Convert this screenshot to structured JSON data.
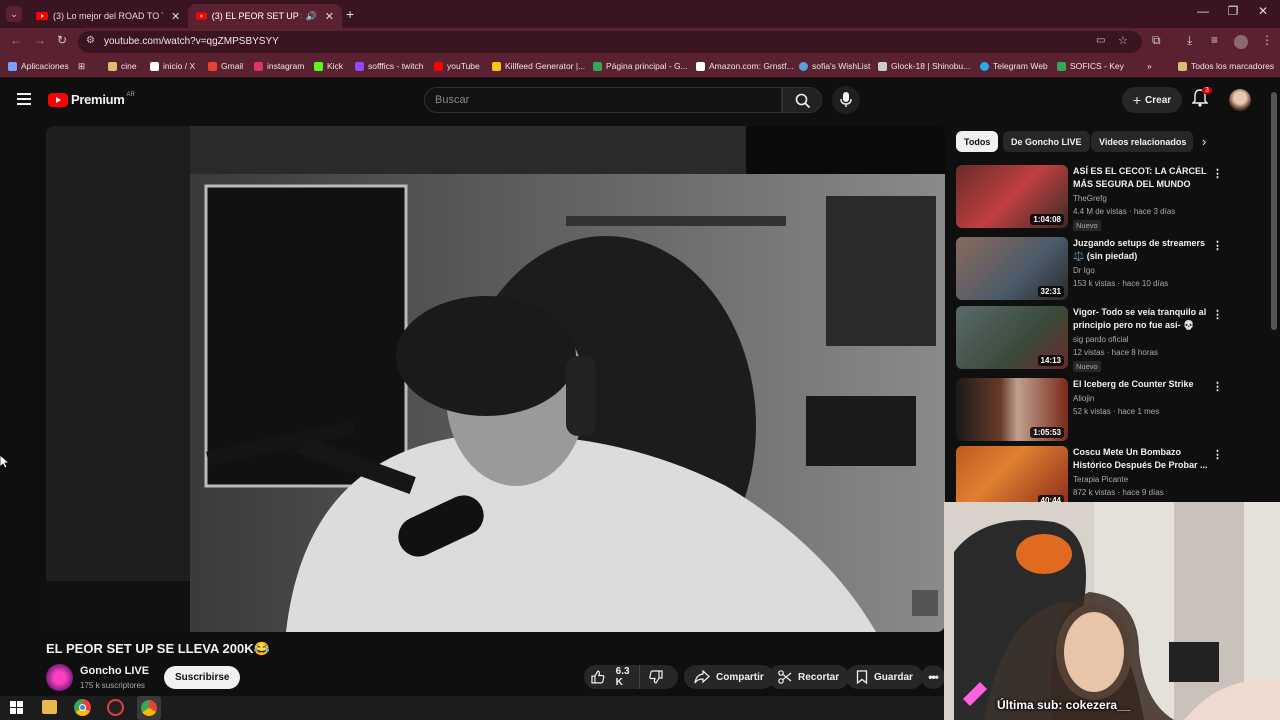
{
  "browser": {
    "tabs": [
      {
        "title": "(3) Lo mejor del ROAD TO TOP",
        "active": false
      },
      {
        "title": "(3) EL PEOR SET UP SE LLEV",
        "active": true
      }
    ],
    "url": "youtube.com/watch?v=qgZMPSBYSYY",
    "bookmarks": [
      {
        "label": "Aplicaciones",
        "color": "#7aa0ff"
      },
      {
        "label": "cine",
        "color": "#d8c070"
      },
      {
        "label": "inicio / X",
        "color": "#ffffff"
      },
      {
        "label": "Gmail",
        "color": "#ea4335"
      },
      {
        "label": "instagram",
        "color": "#e1306c"
      },
      {
        "label": "Kick",
        "color": "#53fc18"
      },
      {
        "label": "sofffics - twitch",
        "color": "#9146ff"
      },
      {
        "label": "youTube",
        "color": "#ff0000"
      },
      {
        "label": "Killfeed Generator |...",
        "color": "#f5c518"
      },
      {
        "label": "Página principal - G...",
        "color": "#34a853"
      },
      {
        "label": "Amazon.com: Grnstf...",
        "color": "#ffffff"
      },
      {
        "label": "sofia's WishList",
        "color": "#5aa0e0"
      },
      {
        "label": "Glock-18 | Shinobu...",
        "color": "#cccccc"
      },
      {
        "label": "Telegram Web",
        "color": "#2aabee"
      },
      {
        "label": "SOFICS - Key",
        "color": "#34a853"
      },
      {
        "label": "Todos los marcadores",
        "color": "#d8c070"
      }
    ]
  },
  "youtube": {
    "logo_text": "Premium",
    "region": "AR",
    "search_placeholder": "Buscar",
    "create_label": "Crear",
    "notif_count": "3"
  },
  "video": {
    "title": "EL PEOR SET UP SE LLEVA 200K😂",
    "channel": "Goncho LIVE",
    "subscribers": "175 k suscriptores",
    "subscribe_label": "Suscribirse",
    "likes": "6.3 K",
    "share_label": "Compartir",
    "clip_label": "Recortar",
    "save_label": "Guardar"
  },
  "sidebar": {
    "chips": [
      "Todos",
      "De Goncho LIVE",
      "Videos relacionados"
    ],
    "recommendations": [
      {
        "title": "ASÍ ES EL CECOT: LA CÁRCEL MÁS SEGURA DEL MUNDO",
        "channel": "TheGrefg",
        "meta": "4.4 M de vistas · hace 3 días",
        "duration": "1:04:08",
        "badge": "Nuevo",
        "color": "#b24040"
      },
      {
        "title": "Juzgando setups de streamers ⚖️ (sin piedad)",
        "channel": "Dr Igo",
        "meta": "153 k vistas · hace 10 días",
        "duration": "32:31",
        "badge": "",
        "color": "#6a7a8a"
      },
      {
        "title": "Vigor- Todo se veía tranquilo al principio pero no fue así- 💀",
        "channel": "sig pardo oficial",
        "meta": "12 vistas · hace 8 horas",
        "duration": "14:13",
        "badge": "Nuevo",
        "color": "#4a5a4a"
      },
      {
        "title": "El Iceberg de Counter Strike",
        "channel": "Aliojin",
        "meta": "52 k vistas · hace 1 mes",
        "duration": "1:05:53",
        "badge": "",
        "color": "#5a2a1a"
      },
      {
        "title": "Coscu Mete Un Bombazo Histórico Después De Probar ...",
        "channel": "Terapia Picante",
        "meta": "872 k vistas · hace 9 días",
        "duration": "40:44",
        "badge": "",
        "color": "#c04a20"
      }
    ]
  },
  "overlay": {
    "last_sub": "Última sub: cokezera__"
  }
}
